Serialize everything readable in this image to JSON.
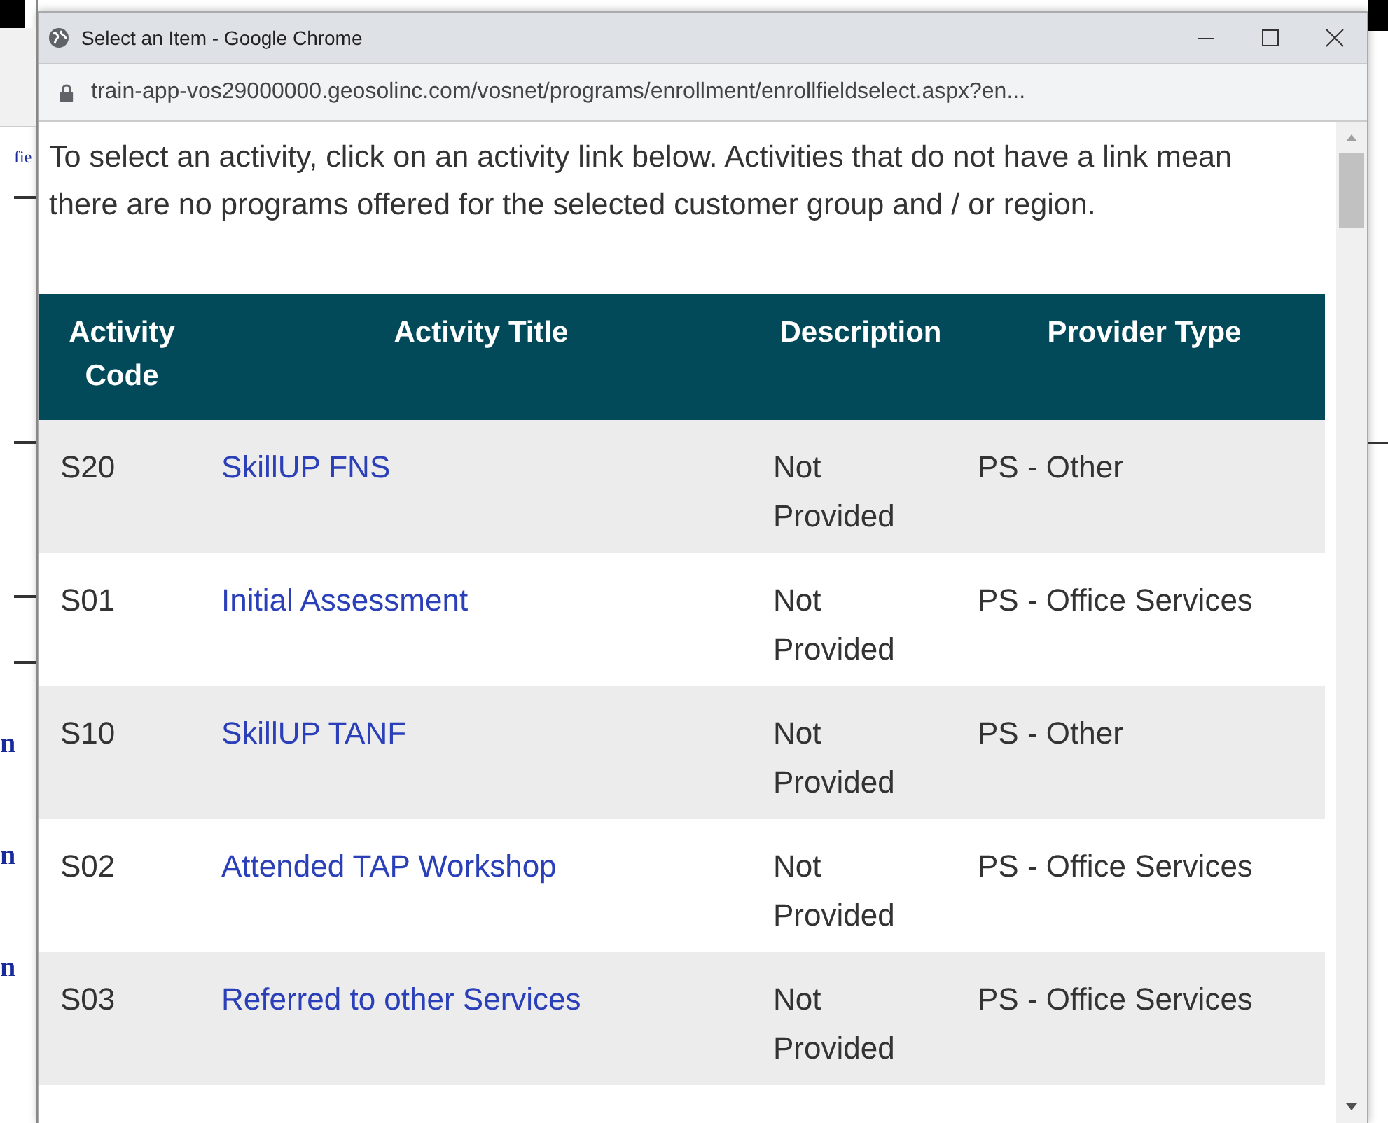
{
  "background_fragments": [
    "fie",
    "n",
    "n",
    "n"
  ],
  "window": {
    "title": "Select an Item - Google Chrome",
    "url": "train-app-vos29000000.geosolinc.com/vosnet/programs/enrollment/enrollfieldselect.aspx?en..."
  },
  "intro": "To select an activity, click on an activity link below. Activities that do not have a link mean there are no programs offered for the selected customer group and / or region.",
  "table": {
    "columns": [
      "Activity Code",
      "Activity Title",
      "Description",
      "Provider Type"
    ],
    "rows": [
      {
        "code": "S20",
        "title": "SkillUP FNS",
        "description": "Not Provided",
        "provider": "PS - Other"
      },
      {
        "code": "S01",
        "title": "Initial Assessment",
        "description": "Not Provided",
        "provider": "PS - Office Services"
      },
      {
        "code": "S10",
        "title": "SkillUP TANF",
        "description": "Not Provided",
        "provider": "PS - Other"
      },
      {
        "code": "S02",
        "title": "Attended TAP Workshop",
        "description": "Not Provided",
        "provider": "PS - Office Services"
      },
      {
        "code": "S03",
        "title": "Referred to other Services",
        "description": "Not Provided",
        "provider": "PS - Office Services"
      }
    ]
  }
}
